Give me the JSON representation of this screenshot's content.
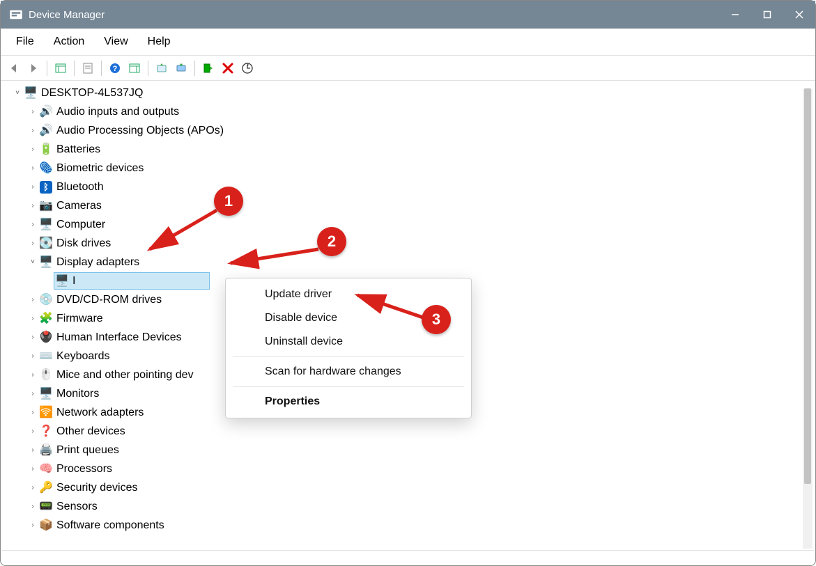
{
  "window": {
    "title": "Device Manager"
  },
  "menu": {
    "file": "File",
    "action": "Action",
    "view": "View",
    "help": "Help"
  },
  "tree": {
    "root": "DESKTOP-4L537JQ",
    "items": [
      {
        "label": "Audio inputs and outputs",
        "icon": "🔊"
      },
      {
        "label": "Audio Processing Objects (APOs)",
        "icon": "🔊"
      },
      {
        "label": "Batteries",
        "icon": "🔋"
      },
      {
        "label": "Biometric devices",
        "icon": "🫆"
      },
      {
        "label": "Bluetooth",
        "icon": "ᛒ"
      },
      {
        "label": "Cameras",
        "icon": "📷"
      },
      {
        "label": "Computer",
        "icon": "🖥️"
      },
      {
        "label": "Disk drives",
        "icon": "💽"
      },
      {
        "label": "Display adapters",
        "icon": "🖥️",
        "expanded": true,
        "selectedChild": "I"
      },
      {
        "label": "DVD/CD-ROM drives",
        "icon": "💿"
      },
      {
        "label": "Firmware",
        "icon": "🧩"
      },
      {
        "label": "Human Interface Devices",
        "icon": "🖲️"
      },
      {
        "label": "Keyboards",
        "icon": "⌨️"
      },
      {
        "label": "Mice and other pointing dev",
        "icon": "🖱️"
      },
      {
        "label": "Monitors",
        "icon": "🖥️"
      },
      {
        "label": "Network adapters",
        "icon": "🛜"
      },
      {
        "label": "Other devices",
        "icon": "❓"
      },
      {
        "label": "Print queues",
        "icon": "🖨️"
      },
      {
        "label": "Processors",
        "icon": "🧠"
      },
      {
        "label": "Security devices",
        "icon": "🔑"
      },
      {
        "label": "Sensors",
        "icon": "📟"
      },
      {
        "label": "Software components",
        "icon": "📦"
      }
    ]
  },
  "context_menu": {
    "update": "Update driver",
    "disable": "Disable device",
    "uninstall": "Uninstall device",
    "scan": "Scan for hardware changes",
    "properties": "Properties"
  },
  "callouts": {
    "one": "1",
    "two": "2",
    "three": "3"
  }
}
